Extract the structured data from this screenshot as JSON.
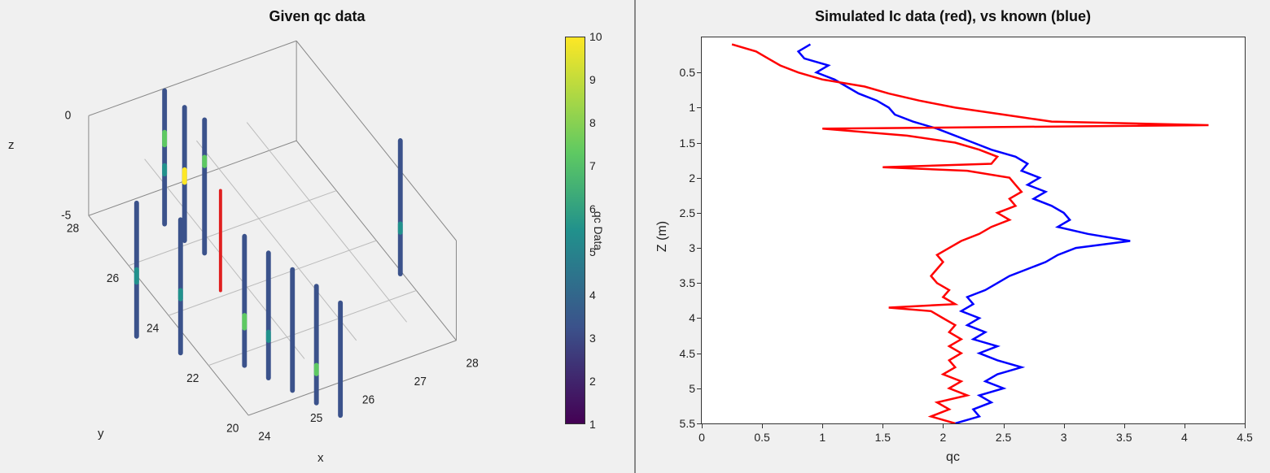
{
  "chart_data": [
    {
      "type": "scatter3d",
      "title": "Given qc data",
      "xlabel": "x",
      "ylabel": "y",
      "zlabel": "z",
      "xlim": [
        24,
        28
      ],
      "ylim": [
        20,
        28
      ],
      "zlim": [
        -5,
        0
      ],
      "xticks": [
        24,
        25,
        26,
        27,
        28
      ],
      "yticks": [
        20,
        22,
        24,
        26,
        28
      ],
      "zticks": [
        -5,
        0
      ],
      "colorbar": {
        "label": "qc Data",
        "min": 1,
        "max": 10,
        "ticks": [
          1,
          2,
          3,
          4,
          5,
          6,
          7,
          8,
          9,
          10
        ],
        "colormap": "parula"
      },
      "boreholes": [
        {
          "x": 24.3,
          "y": 27.8,
          "z_top": 0.0,
          "z_bot": -5.2,
          "qc_range": [
            1,
            8
          ]
        },
        {
          "x": 24.8,
          "y": 27.6,
          "z_top": -0.2,
          "z_bot": -5.3,
          "qc_range": [
            1,
            6
          ]
        },
        {
          "x": 25.1,
          "y": 27.4,
          "z_top": -0.3,
          "z_bot": -5.4,
          "qc_range": [
            1,
            7
          ]
        },
        {
          "x": 24.4,
          "y": 26.0,
          "z_top": -0.3,
          "z_bot": -5.5,
          "qc_range": [
            1,
            5
          ]
        },
        {
          "x": 25.0,
          "y": 26.0,
          "z_top": -0.5,
          "z_bot": -5.6,
          "qc_range": [
            1,
            5
          ]
        },
        {
          "x": 25.3,
          "y": 24.2,
          "z_top": -0.8,
          "z_bot": -5.7,
          "qc_range": [
            1,
            9
          ]
        },
        {
          "x": 25.6,
          "y": 23.6,
          "z_top": -0.9,
          "z_bot": -5.7,
          "qc_range": [
            1,
            6
          ]
        },
        {
          "x": 25.9,
          "y": 23.0,
          "z_top": -1.0,
          "z_bot": -5.8,
          "qc_range": [
            1,
            5
          ]
        },
        {
          "x": 26.2,
          "y": 22.4,
          "z_top": -1.1,
          "z_bot": -5.8,
          "qc_range": [
            1,
            4
          ]
        },
        {
          "x": 26.5,
          "y": 21.8,
          "z_top": -1.2,
          "z_bot": -5.9,
          "qc_range": [
            1,
            5
          ]
        },
        {
          "x": 26.8,
          "y": 21.2,
          "z_top": -1.3,
          "z_bot": -5.9,
          "qc_range": [
            1,
            4
          ]
        },
        {
          "x": 27.3,
          "y": 26.4,
          "z_top": -0.3,
          "z_bot": -5.0,
          "qc_range": [
            1,
            4
          ]
        },
        {
          "x": 25.1,
          "y": 25.0,
          "z_top": -0.8,
          "z_bot": -4.2,
          "highlight": true,
          "qc_range": [
            0,
            0
          ]
        }
      ]
    },
    {
      "type": "line",
      "title": "Simulated Ic data (red), vs known (blue)",
      "xlabel": "qc",
      "ylabel": "Z (m)",
      "xlim": [
        0,
        4.5
      ],
      "ylim": [
        5.5,
        0.0
      ],
      "y_inverted": true,
      "xticks": [
        0,
        0.5,
        1,
        1.5,
        2,
        2.5,
        3,
        3.5,
        4,
        4.5
      ],
      "yticks": [
        0.5,
        1,
        1.5,
        2,
        2.5,
        3,
        3.5,
        4,
        4.5,
        5,
        5.5
      ],
      "series": [
        {
          "name": "known",
          "color": "#0000ff",
          "z": [
            0.1,
            0.2,
            0.3,
            0.4,
            0.5,
            0.6,
            0.7,
            0.8,
            0.9,
            1.0,
            1.1,
            1.2,
            1.3,
            1.4,
            1.5,
            1.6,
            1.7,
            1.8,
            1.9,
            2.0,
            2.1,
            2.2,
            2.3,
            2.4,
            2.5,
            2.6,
            2.7,
            2.8,
            2.9,
            3.0,
            3.1,
            3.2,
            3.3,
            3.4,
            3.5,
            3.6,
            3.7,
            3.8,
            3.9,
            4.0,
            4.1,
            4.2,
            4.3,
            4.4,
            4.5,
            4.6,
            4.7,
            4.8,
            4.9,
            5.0,
            5.1,
            5.2,
            5.3,
            5.4,
            5.5
          ],
          "qc": [
            0.9,
            0.8,
            0.85,
            1.05,
            0.95,
            1.1,
            1.2,
            1.3,
            1.45,
            1.55,
            1.6,
            1.75,
            1.95,
            2.1,
            2.25,
            2.4,
            2.6,
            2.7,
            2.65,
            2.8,
            2.7,
            2.85,
            2.75,
            2.9,
            3.0,
            3.05,
            2.95,
            3.2,
            3.55,
            3.1,
            2.95,
            2.85,
            2.7,
            2.55,
            2.45,
            2.35,
            2.2,
            2.25,
            2.15,
            2.3,
            2.2,
            2.35,
            2.25,
            2.45,
            2.3,
            2.45,
            2.65,
            2.45,
            2.35,
            2.5,
            2.3,
            2.4,
            2.25,
            2.3,
            2.1
          ]
        },
        {
          "name": "simulated",
          "color": "#ff0000",
          "z": [
            0.1,
            0.2,
            0.3,
            0.4,
            0.5,
            0.6,
            0.7,
            0.8,
            0.9,
            1.0,
            1.1,
            1.2,
            1.25,
            1.3,
            1.4,
            1.5,
            1.6,
            1.7,
            1.8,
            1.85,
            1.9,
            2.0,
            2.1,
            2.2,
            2.3,
            2.4,
            2.5,
            2.6,
            2.7,
            2.8,
            2.9,
            3.0,
            3.1,
            3.2,
            3.3,
            3.4,
            3.5,
            3.6,
            3.7,
            3.8,
            3.85,
            3.9,
            4.0,
            4.1,
            4.2,
            4.3,
            4.4,
            4.5,
            4.6,
            4.7,
            4.8,
            4.9,
            5.0,
            5.1,
            5.2,
            5.3,
            5.4,
            5.5
          ],
          "qc": [
            0.25,
            0.45,
            0.55,
            0.65,
            0.8,
            1.0,
            1.35,
            1.55,
            1.8,
            2.1,
            2.5,
            2.9,
            4.2,
            1.0,
            1.7,
            2.1,
            2.3,
            2.45,
            2.4,
            1.5,
            2.2,
            2.55,
            2.6,
            2.65,
            2.55,
            2.6,
            2.45,
            2.55,
            2.4,
            2.3,
            2.15,
            2.05,
            1.95,
            2.0,
            1.95,
            1.9,
            1.95,
            2.05,
            2.0,
            2.1,
            1.55,
            1.9,
            2.0,
            2.1,
            2.05,
            2.15,
            2.05,
            2.15,
            2.05,
            2.1,
            2.0,
            2.15,
            2.05,
            2.2,
            1.95,
            2.05,
            1.9,
            2.1
          ]
        }
      ]
    }
  ]
}
